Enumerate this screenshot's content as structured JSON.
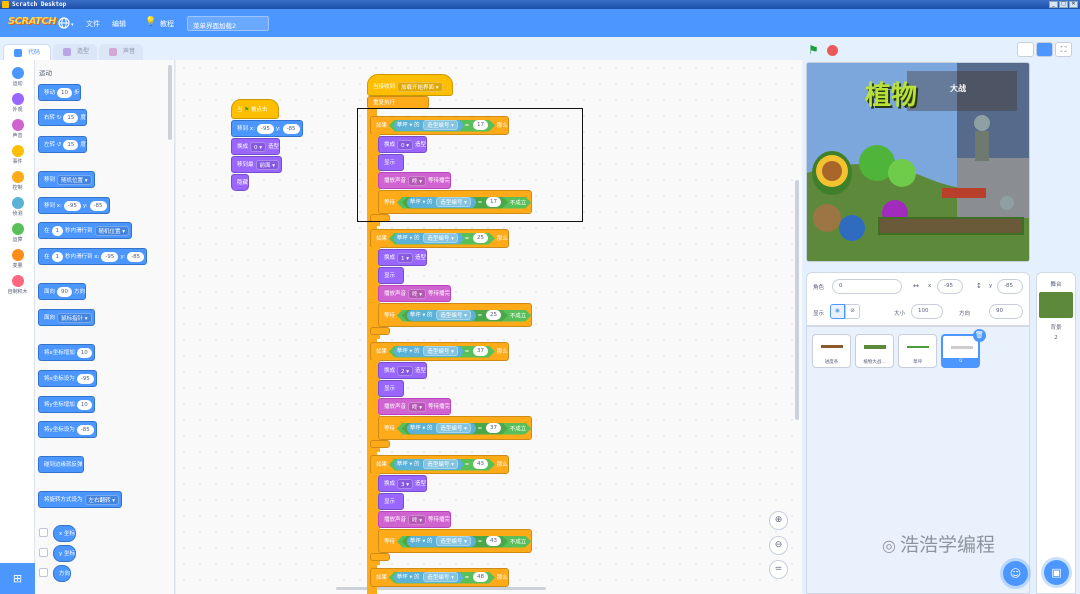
{
  "window": {
    "title": "Scratch Desktop",
    "controls": [
      "_",
      "□",
      "✕"
    ]
  },
  "menubar": {
    "logo": "SCRATCH",
    "language_icon": "globe-icon",
    "file": "文件",
    "edit": "编辑",
    "tutorials": "教程",
    "project_name": "菜单界面加载2"
  },
  "tabs": {
    "code": "代码",
    "costumes": "造型",
    "sounds": "声音"
  },
  "categories": [
    {
      "label": "运动",
      "color": "#4c97ff"
    },
    {
      "label": "外观",
      "color": "#9966ff"
    },
    {
      "label": "声音",
      "color": "#cf63cf"
    },
    {
      "label": "事件",
      "color": "#ffbf00"
    },
    {
      "label": "控制",
      "color": "#ffab19"
    },
    {
      "label": "侦测",
      "color": "#5cb1d6"
    },
    {
      "label": "运算",
      "color": "#59c059"
    },
    {
      "label": "变量",
      "color": "#ff8c1a"
    },
    {
      "label": "自制积木",
      "color": "#ff6680"
    }
  ],
  "palette": {
    "section": "运动",
    "move": "移动",
    "move_steps": "10",
    "move_unit": "步",
    "turn_right": "右转",
    "turn_right_deg": "15",
    "turn_right_unit": "度",
    "turn_left": "左转",
    "turn_left_deg": "15",
    "turn_left_unit": "度",
    "goto": "移到",
    "goto_target": "随机位置",
    "goto_xy": "移到 x:",
    "goto_x": "-95",
    "goto_y_label": "y:",
    "goto_y": "-85",
    "glide_in": "在",
    "glide_secs": "1",
    "glide_to": "秒内滑行到",
    "glide_target": "随机位置",
    "glide2_in": "在",
    "glide2_secs": "1",
    "glide2_to": "秒内滑行到 x:",
    "glide2_x": "-95",
    "glide2_y_label": "y:",
    "glide2_y": "-85",
    "point_dir": "面向",
    "point_dir_val": "90",
    "point_dir_unit": "方向",
    "point_towards": "面向",
    "point_towards_target": "鼠标指针",
    "change_x": "将x坐标增加",
    "change_x_val": "10",
    "set_x": "将x坐标设为",
    "set_x_val": "-95",
    "change_y": "将y坐标增加",
    "change_y_val": "10",
    "set_y": "将y坐标设为",
    "set_y_val": "-85",
    "bounce": "碰到边缘就反弹",
    "rotation_style": "将旋转方式设为",
    "rotation_style_val": "左右翻转",
    "x_pos": "x 坐标",
    "y_pos": "y 坐标",
    "direction": "方向"
  },
  "script1": {
    "hat": "当",
    "hat_suffix": "被点击",
    "goto": "移到 x:",
    "x": "-95",
    "y_label": "y:",
    "y": "-85",
    "switch": "换成",
    "costume": "0",
    "costume_suffix": "造型",
    "layer": "移到最",
    "layer_val": "前面",
    "hide": "隐藏"
  },
  "script2": {
    "hat": "当接收到",
    "hat_msg": "加载开始界面",
    "forever": "重复执行",
    "if": "如果",
    "then": "那么",
    "of": "的",
    "costume_num": "造型编号",
    "eq": "=",
    "lawn": "草坪",
    "switch": "换成",
    "costume_suffix": "造型",
    "show": "显示",
    "play": "播放声音",
    "snd": "咚",
    "play_suffix": "等待播完",
    "wait_until": "等待",
    "not_true": "不成立",
    "rows": [
      {
        "v": "17",
        "costume": "0"
      },
      {
        "v": "25",
        "costume": "1"
      },
      {
        "v": "37",
        "costume": "2"
      },
      {
        "v": "43",
        "costume": "3"
      },
      {
        "v": "48"
      }
    ]
  },
  "zoom": {
    "in": "zoom-in-icon",
    "out": "zoom-out-icon",
    "reset": "="
  },
  "stage_logo": {
    "text": "植物",
    "sub": "大战"
  },
  "sprite_info": {
    "sprite_label": "角色",
    "sprite_name": "0",
    "x_label": "x",
    "x": "-95",
    "y_label": "y",
    "y": "-85",
    "show_label": "显示",
    "size_label": "大小",
    "size": "100",
    "dir_label": "方向",
    "dir": "90"
  },
  "sprites": [
    {
      "name": "进度条"
    },
    {
      "name": "植物大战..."
    },
    {
      "name": "草坪"
    },
    {
      "name": "0"
    }
  ],
  "stage_panel": {
    "title": "舞台",
    "backdrops_label": "背景",
    "backdrops_count": "2"
  },
  "watermark": "浩浩学编程",
  "colors": {
    "brand": "#4c97ff",
    "motion": "#4c97ff",
    "looks": "#9966ff",
    "sound": "#cf63cf",
    "events": "#ffbf00",
    "control": "#ffab19",
    "sensing": "#5cb1d6",
    "operators": "#59c059"
  }
}
